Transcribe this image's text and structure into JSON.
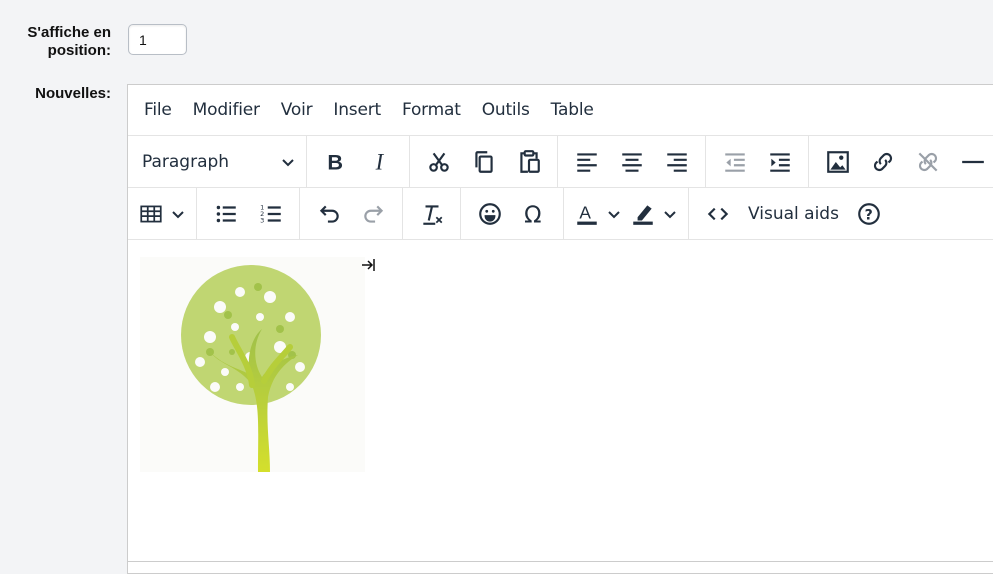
{
  "form": {
    "position_label": "S'affiche en position:",
    "position_value": "1",
    "news_label": "Nouvelles:"
  },
  "editor": {
    "menu": [
      "File",
      "Modifier",
      "Voir",
      "Insert",
      "Format",
      "Outils",
      "Table"
    ],
    "blocks_value": "Paragraph",
    "visual_aids_label": "Visual aids",
    "colors": {
      "text": "#222f3e",
      "tree_green": "#c5d62f",
      "tree_leaves": "#a8c84a"
    }
  },
  "icons": [
    "bold-icon",
    "italic-icon",
    "cut-icon",
    "copy-icon",
    "paste-icon",
    "align-left-icon",
    "align-center-icon",
    "align-right-icon",
    "outdent-icon",
    "indent-icon",
    "image-icon",
    "link-icon",
    "unlink-icon",
    "horizontal-rule-icon",
    "table-icon",
    "bullet-list-icon",
    "numbered-list-icon",
    "undo-icon",
    "redo-icon",
    "clear-formatting-icon",
    "emoji-icon",
    "special-char-icon",
    "text-color-icon",
    "highlight-icon",
    "source-code-icon",
    "help-icon"
  ]
}
